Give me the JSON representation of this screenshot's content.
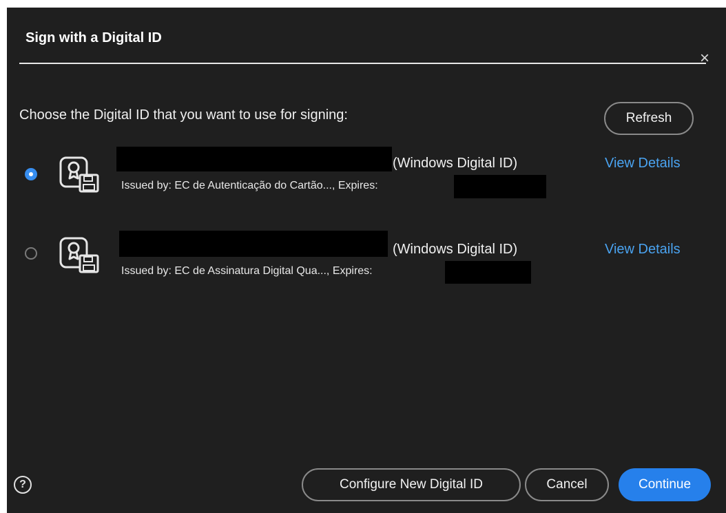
{
  "dialog": {
    "title": "Sign with a Digital ID",
    "close_glyph": "×",
    "prompt": "Choose the Digital ID that you want to use for signing:",
    "refresh_label": "Refresh"
  },
  "digital_ids": [
    {
      "selected": true,
      "type_label": "(Windows Digital ID)",
      "issuer_text": "Issued by: EC de Autenticação do Cartão..., Expires:",
      "view_details_label": "View Details",
      "icon": "certificate-icon"
    },
    {
      "selected": false,
      "type_label": "(Windows Digital ID)",
      "issuer_text": "Issued by: EC de Assinatura Digital Qua..., Expires:",
      "view_details_label": "View Details",
      "icon": "certificate-icon"
    }
  ],
  "footer": {
    "help_glyph": "?",
    "configure_label": "Configure New Digital ID",
    "cancel_label": "Cancel",
    "continue_label": "Continue"
  },
  "colors": {
    "background": "#1f1f1f",
    "accent": "#2680eb",
    "link": "#4aa3f0"
  }
}
